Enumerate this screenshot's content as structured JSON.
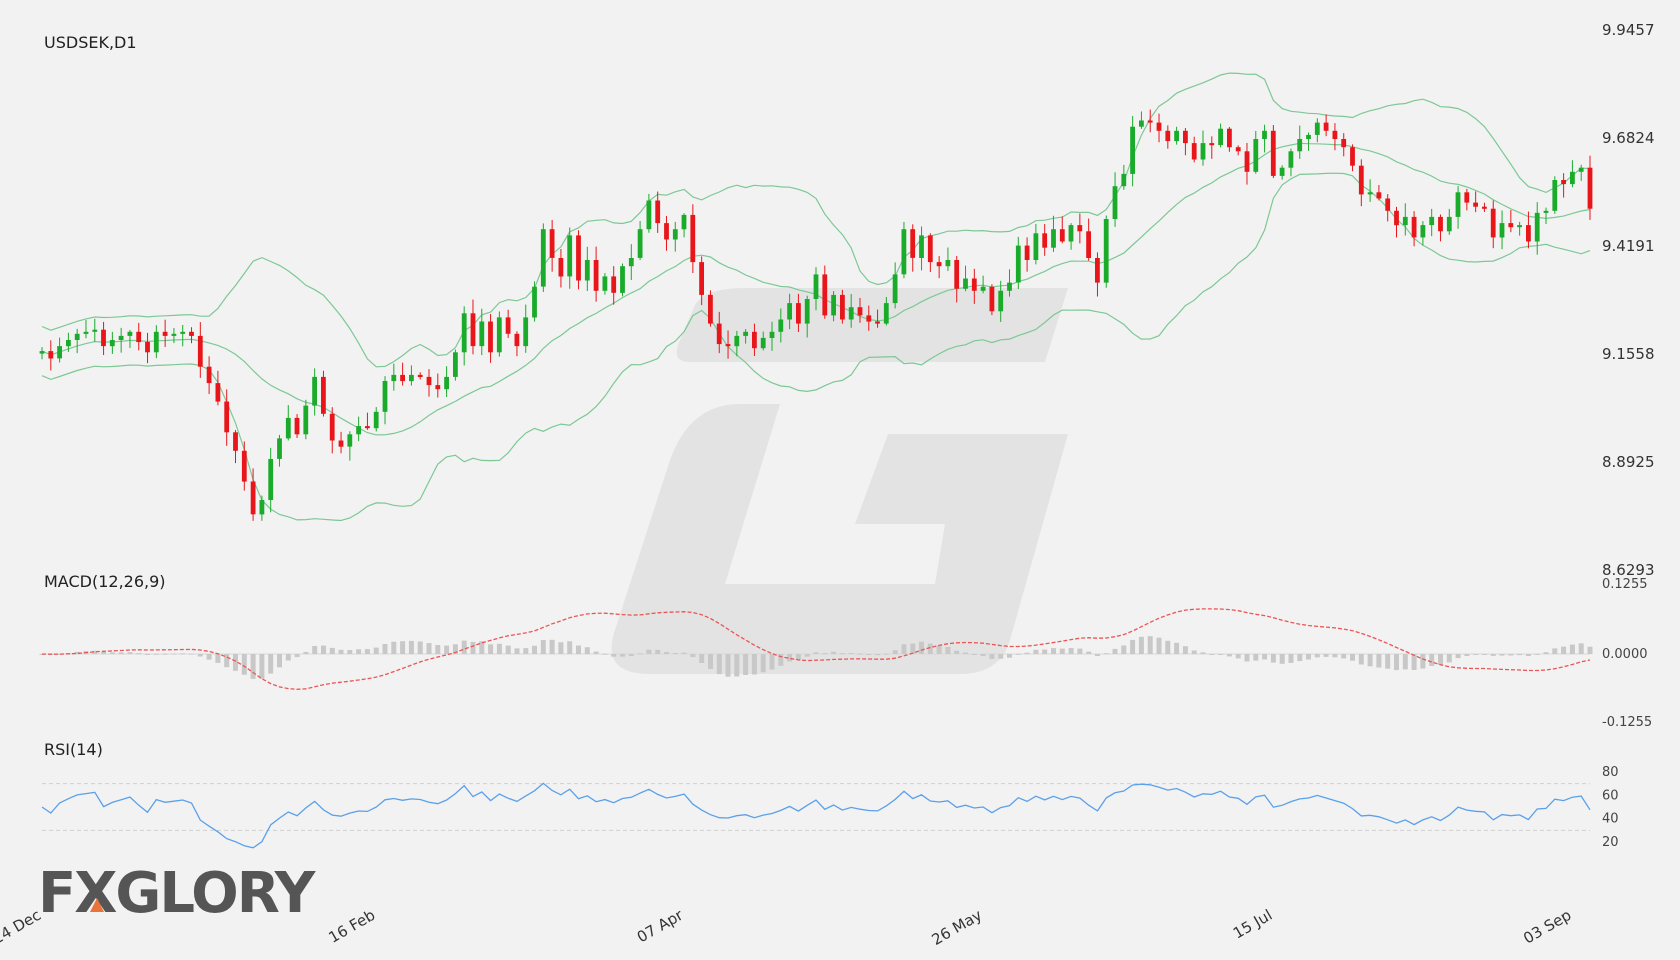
{
  "chart_data": {
    "type": "candlestick",
    "symbol": "USDSEK,D1",
    "price_axis": {
      "ylim": [
        8.6293,
        9.9457
      ],
      "ticks": [
        "9.9457",
        "9.6824",
        "9.4191",
        "9.1558",
        "8.8925",
        "8.6293"
      ]
    },
    "x_labels": [
      "24 Dec",
      "16 Feb",
      "07 Apr",
      "26 May",
      "15 Jul",
      "03 Sep"
    ],
    "x_label_index": [
      0,
      38,
      73,
      107,
      140,
      174
    ],
    "close": [
      9.163,
      9.145,
      9.175,
      9.19,
      9.205,
      9.21,
      9.215,
      9.175,
      9.19,
      9.2,
      9.21,
      9.185,
      9.16,
      9.21,
      9.2,
      9.205,
      9.21,
      9.2,
      9.125,
      9.085,
      9.04,
      8.965,
      8.92,
      8.845,
      8.765,
      8.8,
      8.9,
      8.95,
      9.0,
      8.96,
      9.03,
      9.1,
      9.01,
      8.945,
      8.93,
      8.96,
      8.98,
      8.975,
      9.015,
      9.09,
      9.105,
      9.09,
      9.105,
      9.1,
      9.08,
      9.07,
      9.1,
      9.16,
      9.255,
      9.175,
      9.235,
      9.16,
      9.245,
      9.205,
      9.175,
      9.245,
      9.32,
      9.46,
      9.39,
      9.345,
      9.445,
      9.335,
      9.385,
      9.31,
      9.345,
      9.305,
      9.37,
      9.39,
      9.46,
      9.53,
      9.475,
      9.435,
      9.46,
      9.495,
      9.38,
      9.3,
      9.23,
      9.18,
      9.175,
      9.2,
      9.21,
      9.17,
      9.195,
      9.21,
      9.24,
      9.28,
      9.23,
      9.29,
      9.35,
      9.25,
      9.3,
      9.24,
      9.27,
      9.25,
      9.235,
      9.23,
      9.28,
      9.35,
      9.46,
      9.39,
      9.445,
      9.38,
      9.37,
      9.385,
      9.315,
      9.34,
      9.31,
      9.32,
      9.26,
      9.31,
      9.33,
      9.42,
      9.385,
      9.45,
      9.415,
      9.46,
      9.43,
      9.47,
      9.455,
      9.39,
      9.33,
      9.485,
      9.565,
      9.595,
      9.71,
      9.725,
      9.72,
      9.7,
      9.675,
      9.7,
      9.67,
      9.63,
      9.67,
      9.665,
      9.705,
      9.66,
      9.65,
      9.6,
      9.68,
      9.7,
      9.59,
      9.61,
      9.65,
      9.68,
      9.69,
      9.72,
      9.7,
      9.68,
      9.66,
      9.615,
      9.545,
      9.55,
      9.535,
      9.505,
      9.47,
      9.49,
      9.44,
      9.47,
      9.49,
      9.455,
      9.49,
      9.55,
      9.525,
      9.515,
      9.51,
      9.44,
      9.475,
      9.465,
      9.47,
      9.43,
      9.5,
      9.505,
      9.58,
      9.57,
      9.6,
      9.61,
      9.51
    ],
    "indicators": {
      "bollinger": "Bollinger Bands",
      "macd": {
        "label": "MACD(12,26,9)",
        "ylim": [
          -0.1255,
          0.1255
        ],
        "ticks": [
          "0.1255",
          "0.0000",
          "-0.1255"
        ]
      },
      "rsi": {
        "label": "RSI(14)",
        "ylim": [
          20,
          80
        ],
        "ticks": [
          "80",
          "60",
          "40",
          "20"
        ],
        "levels": [
          70,
          30
        ]
      }
    },
    "colors": {
      "bull": "#1aab2b",
      "bear": "#e8161a",
      "bands": "#7cc895",
      "macd_signal": "#ec5555",
      "macd_hist": "#c8c8c8",
      "rsi": "#5aa0ea",
      "grid_dash": "#cfcfcf",
      "background": "#f2f2f2",
      "watermark": "#dedede"
    }
  },
  "logo": {
    "text": "FXGLORY"
  }
}
